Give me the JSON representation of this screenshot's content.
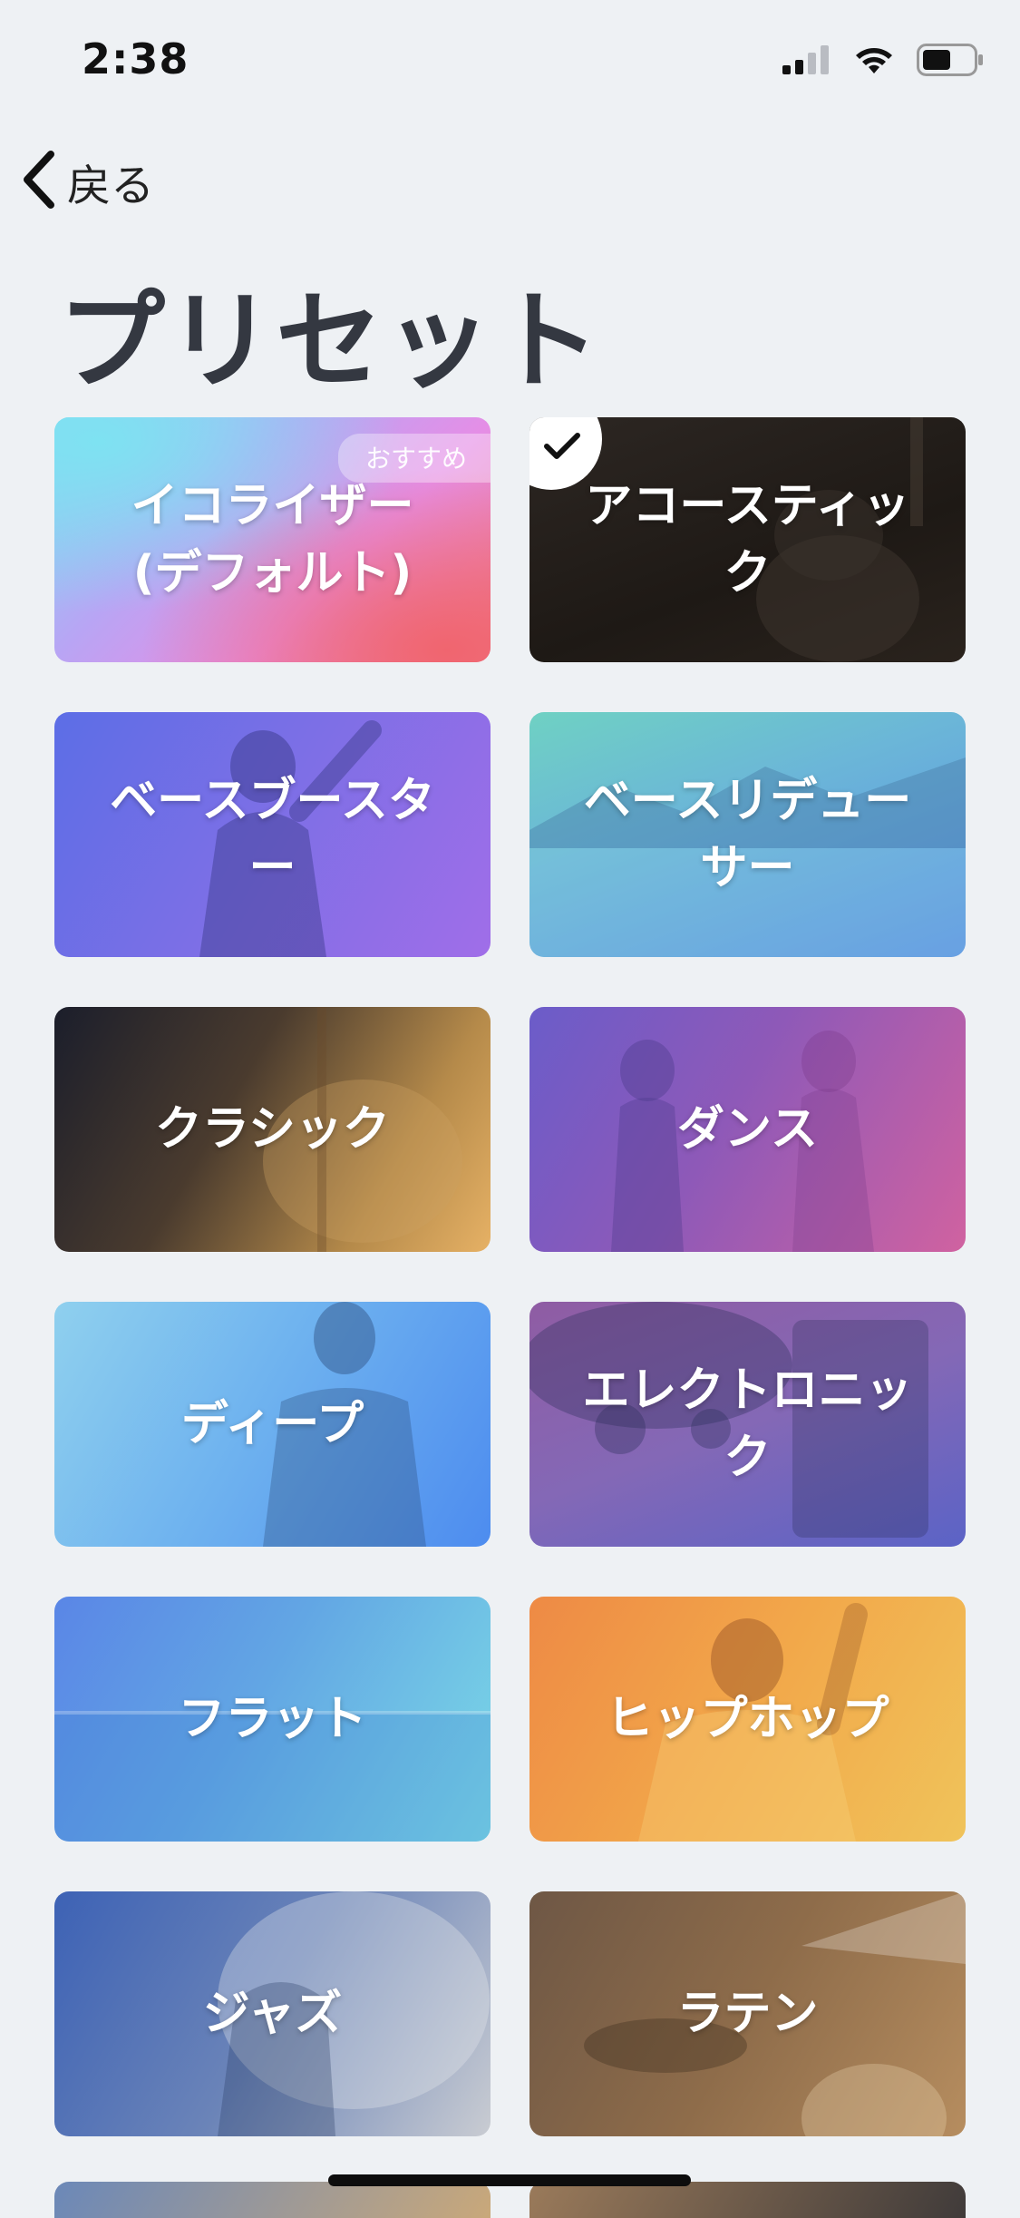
{
  "status_bar": {
    "time": "2:38",
    "icons": [
      "cellular-signal-icon",
      "wifi-icon",
      "battery-icon"
    ]
  },
  "nav": {
    "back_label": "戻る"
  },
  "page": {
    "title": "プリセット"
  },
  "presets": [
    {
      "id": "equalizer-default",
      "label": "イコライザー\n(デフォルト)",
      "badge": "おすすめ",
      "selected": false
    },
    {
      "id": "acoustic",
      "label": "アコースティッ\nク",
      "badge": "",
      "selected": true
    },
    {
      "id": "bass-booster",
      "label": "ベースブースタ\nー",
      "badge": "",
      "selected": false
    },
    {
      "id": "bass-reducer",
      "label": "ベースリデュー\nサー",
      "badge": "",
      "selected": false
    },
    {
      "id": "classic",
      "label": "クラシック",
      "badge": "",
      "selected": false
    },
    {
      "id": "dance",
      "label": "ダンス",
      "badge": "",
      "selected": false
    },
    {
      "id": "deep",
      "label": "ディープ",
      "badge": "",
      "selected": false
    },
    {
      "id": "electronic",
      "label": "エレクトロニッ\nク",
      "badge": "",
      "selected": false
    },
    {
      "id": "flat",
      "label": "フラット",
      "badge": "",
      "selected": false
    },
    {
      "id": "hip-hop",
      "label": "ヒップホップ",
      "badge": "",
      "selected": false
    },
    {
      "id": "jazz",
      "label": "ジャズ",
      "badge": "",
      "selected": false
    },
    {
      "id": "latin",
      "label": "ラテン",
      "badge": "",
      "selected": false
    }
  ]
}
